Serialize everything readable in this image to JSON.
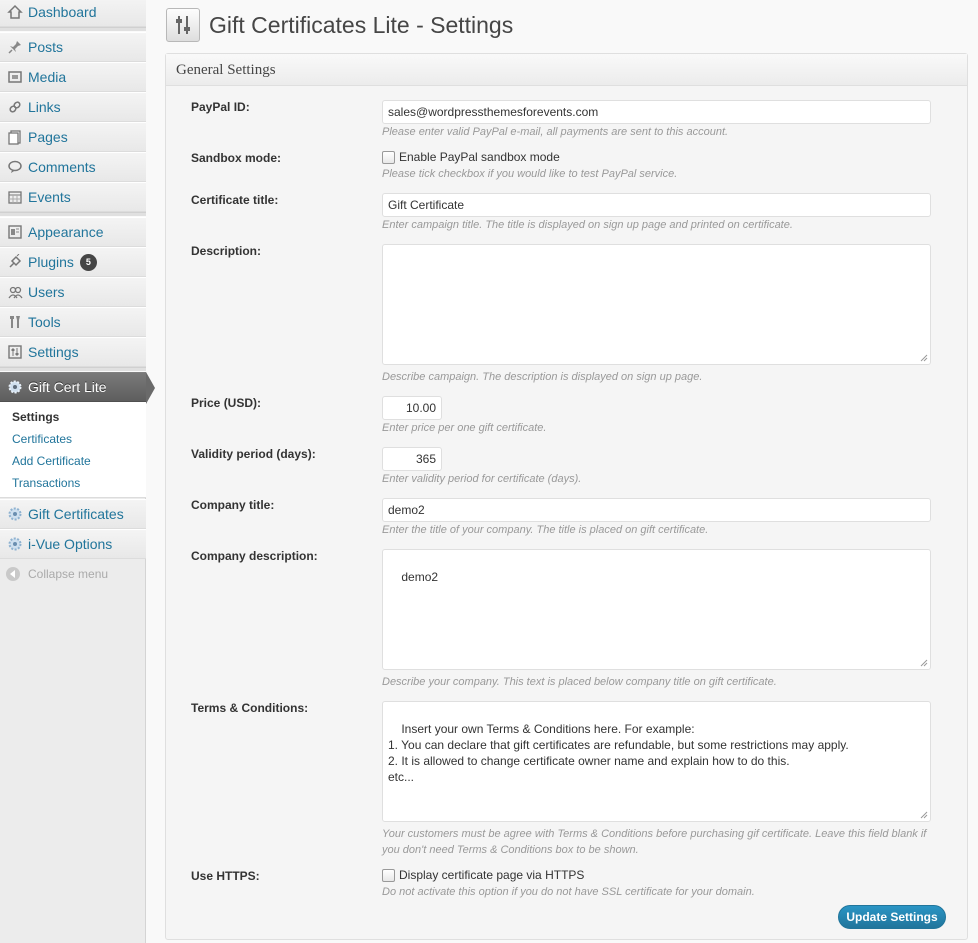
{
  "sidebar": {
    "items": [
      {
        "label": "Dashboard",
        "icon": "dashboard-icon"
      },
      {
        "label": "Posts",
        "icon": "pin-icon"
      },
      {
        "label": "Media",
        "icon": "media-icon"
      },
      {
        "label": "Links",
        "icon": "link-icon"
      },
      {
        "label": "Pages",
        "icon": "pages-icon"
      },
      {
        "label": "Comments",
        "icon": "comment-icon"
      },
      {
        "label": "Events",
        "icon": "calendar-icon"
      },
      {
        "label": "Appearance",
        "icon": "appearance-icon"
      },
      {
        "label": "Plugins",
        "icon": "plugin-icon",
        "badge": "5"
      },
      {
        "label": "Users",
        "icon": "users-icon"
      },
      {
        "label": "Tools",
        "icon": "tools-icon"
      },
      {
        "label": "Settings",
        "icon": "settings-icon"
      },
      {
        "label": "Gift Cert Lite",
        "icon": "gear-icon"
      },
      {
        "label": "Gift Certificates",
        "icon": "gear-icon"
      },
      {
        "label": "i-Vue Options",
        "icon": "gear-icon"
      }
    ],
    "submenu": [
      "Settings",
      "Certificates",
      "Add Certificate",
      "Transactions"
    ],
    "collapse_label": "Collapse menu"
  },
  "header": {
    "title": "Gift Certificates Lite - Settings"
  },
  "panel": {
    "title": "General Settings",
    "paypal_label": "PayPal ID:",
    "paypal_value": "sales@wordpressthemesforevents.com",
    "paypal_hint": "Please enter valid PayPal e-mail, all payments are sent to this account.",
    "sandbox_label": "Sandbox mode:",
    "sandbox_check": "Enable PayPal sandbox mode",
    "sandbox_hint": "Please tick checkbox if you would like to test PayPal service.",
    "cert_title_label": "Certificate title:",
    "cert_title_value": "Gift Certificate",
    "cert_title_hint": "Enter campaign title. The title is displayed on sign up page and printed on certificate.",
    "description_label": "Description:",
    "description_value": "",
    "description_hint": "Describe campaign. The description is displayed on sign up page.",
    "price_label": "Price (USD):",
    "price_value": "10.00",
    "price_hint": "Enter price per one gift certificate.",
    "validity_label": "Validity period (days):",
    "validity_value": "365",
    "validity_hint": "Enter validity period for certificate (days).",
    "company_title_label": "Company title:",
    "company_title_value": "demo2",
    "company_title_hint": "Enter the title of your company. The title is placed on gift certificate.",
    "company_desc_label": "Company description:",
    "company_desc_value": "demo2",
    "company_desc_hint": "Describe your company. This text is placed below company title on gift certificate.",
    "terms_label": "Terms & Conditions:",
    "terms_value": "Insert your own Terms & Conditions here. For example:\n1. You can declare that gift certificates are refundable, but some restrictions may apply.\n2. It is allowed to change certificate owner name and explain how to do this.\netc...",
    "terms_hint": "Your customers must be agree with Terms & Conditions before purchasing gif certificate. Leave this field blank if you don't need Terms & Conditions box to be shown.",
    "https_label": "Use HTTPS:",
    "https_check": "Display certificate page via HTTPS",
    "https_hint": "Do not activate this option if you do not have SSL certificate for your domain.",
    "submit_label": "Update Settings"
  },
  "colors": {
    "link": "#21759b",
    "active_menu": "#6a6a6a",
    "primary_button": "#21759b"
  }
}
